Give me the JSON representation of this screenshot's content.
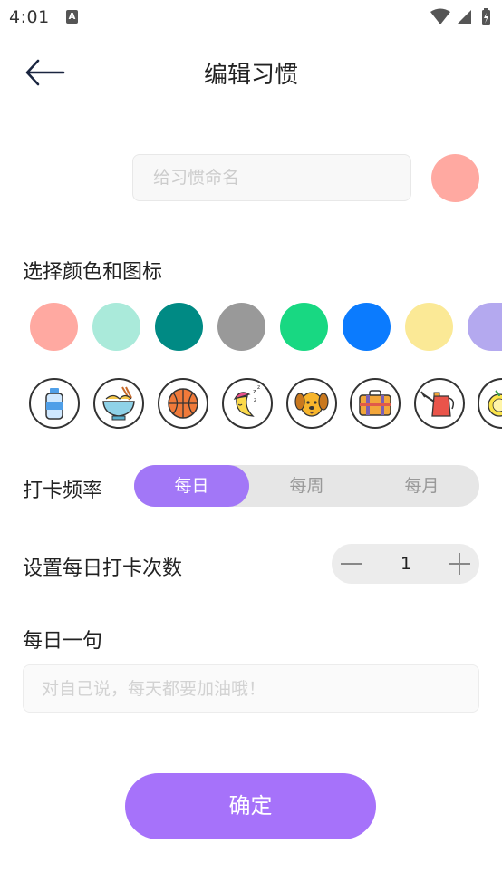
{
  "status_bar": {
    "time": "4:01",
    "notification_glyph": "A"
  },
  "header": {
    "title": "编辑习惯"
  },
  "name_input": {
    "placeholder": "给习惯命名",
    "value": ""
  },
  "selected_color": "#ffa9a1",
  "color_section": {
    "label": "选择颜色和图标",
    "colors": [
      "#ffa9a1",
      "#aaeada",
      "#008a84",
      "#999999",
      "#18d882",
      "#0b7bfe",
      "#fbe996",
      "#b4a9ef"
    ]
  },
  "icons": [
    "water-bottle-icon",
    "noodle-bowl-icon",
    "basketball-icon",
    "sleeping-moon-icon",
    "dog-icon",
    "suitcase-icon",
    "watering-can-icon",
    "lemon-icon"
  ],
  "frequency": {
    "label": "打卡频率",
    "options": [
      "每日",
      "每周",
      "每月"
    ],
    "selected": "每日"
  },
  "daily_count": {
    "label": "设置每日打卡次数",
    "value": "1"
  },
  "daily_quote": {
    "label": "每日一句",
    "placeholder": "对自己说，每天都要加油哦！",
    "value": ""
  },
  "confirm": {
    "label": "确定"
  }
}
